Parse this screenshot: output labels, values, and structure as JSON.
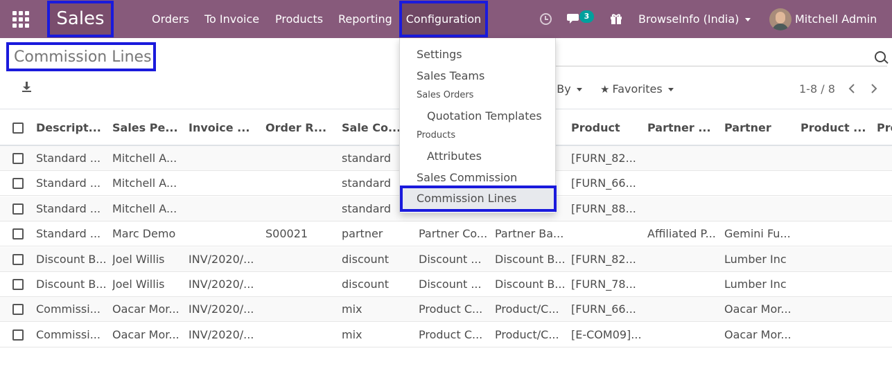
{
  "navbar": {
    "brand": "Sales",
    "menu": [
      "Orders",
      "To Invoice",
      "Products",
      "Reporting"
    ],
    "active_menu": "Configuration",
    "chat_count": "3",
    "company": "BrowseInfo (India)",
    "user": "Mitchell Admin"
  },
  "colors": {
    "navbar": "#875a7b",
    "highlight": "#1a1adc",
    "badge": "#00a09d"
  },
  "page": {
    "title": "Commission Lines"
  },
  "controls": {
    "groupby": "p By",
    "favorites": "Favorites",
    "pager": "1-8 / 8"
  },
  "dropdown": {
    "settings": "Settings",
    "sales_teams": "Sales Teams",
    "sales_orders_header": "Sales Orders",
    "quotation_templates": "Quotation Templates",
    "products_header": "Products",
    "attributes": "Attributes",
    "sales_commission": "Sales Commission",
    "commission_lines": "Commission Lines"
  },
  "table": {
    "headers": [
      "Descript...",
      "Sales Pe...",
      "Invoice ...",
      "Order R...",
      "Sale Co...",
      "",
      "",
      "Product",
      "Partner ...",
      "Partner",
      "Product ...",
      "Pro"
    ],
    "rows": [
      [
        "Standard ...",
        "Mitchell A...",
        "",
        "",
        "standard",
        "",
        "",
        "[FURN_82...",
        "",
        "",
        "",
        ""
      ],
      [
        "Standard ...",
        "Mitchell A...",
        "",
        "",
        "standard",
        "",
        "",
        "[FURN_66...",
        "",
        "",
        "",
        ""
      ],
      [
        "Standard ...",
        "Mitchell A...",
        "",
        "",
        "standard",
        "",
        "",
        "[FURN_88...",
        "",
        "",
        "",
        ""
      ],
      [
        "Standard ...",
        "Marc Demo",
        "",
        "S00021",
        "partner",
        "Partner Co...",
        "Partner Ba...",
        "",
        "Affiliated P...",
        "Gemini Fu...",
        "",
        ""
      ],
      [
        "Discount B...",
        "Joel Willis",
        "INV/2020/...",
        "",
        "discount",
        "Discount ...",
        "Discount B...",
        "[FURN_82...",
        "",
        "Lumber Inc",
        "",
        ""
      ],
      [
        "Discount B...",
        "Joel Willis",
        "INV/2020/...",
        "",
        "discount",
        "Discount ...",
        "Discount B...",
        "[FURN_78...",
        "",
        "Lumber Inc",
        "",
        ""
      ],
      [
        "Commissi...",
        "Oacar Mor...",
        "INV/2020/...",
        "",
        "mix",
        "Product C...",
        "Product/C...",
        "[FURN_66...",
        "",
        "Oacar Mor...",
        "",
        ""
      ],
      [
        "Commissi...",
        "Oacar Mor...",
        "INV/2020/...",
        "",
        "mix",
        "Product C...",
        "Product/C...",
        "[E-COM09]...",
        "",
        "Oacar Mor...",
        "",
        ""
      ]
    ]
  }
}
